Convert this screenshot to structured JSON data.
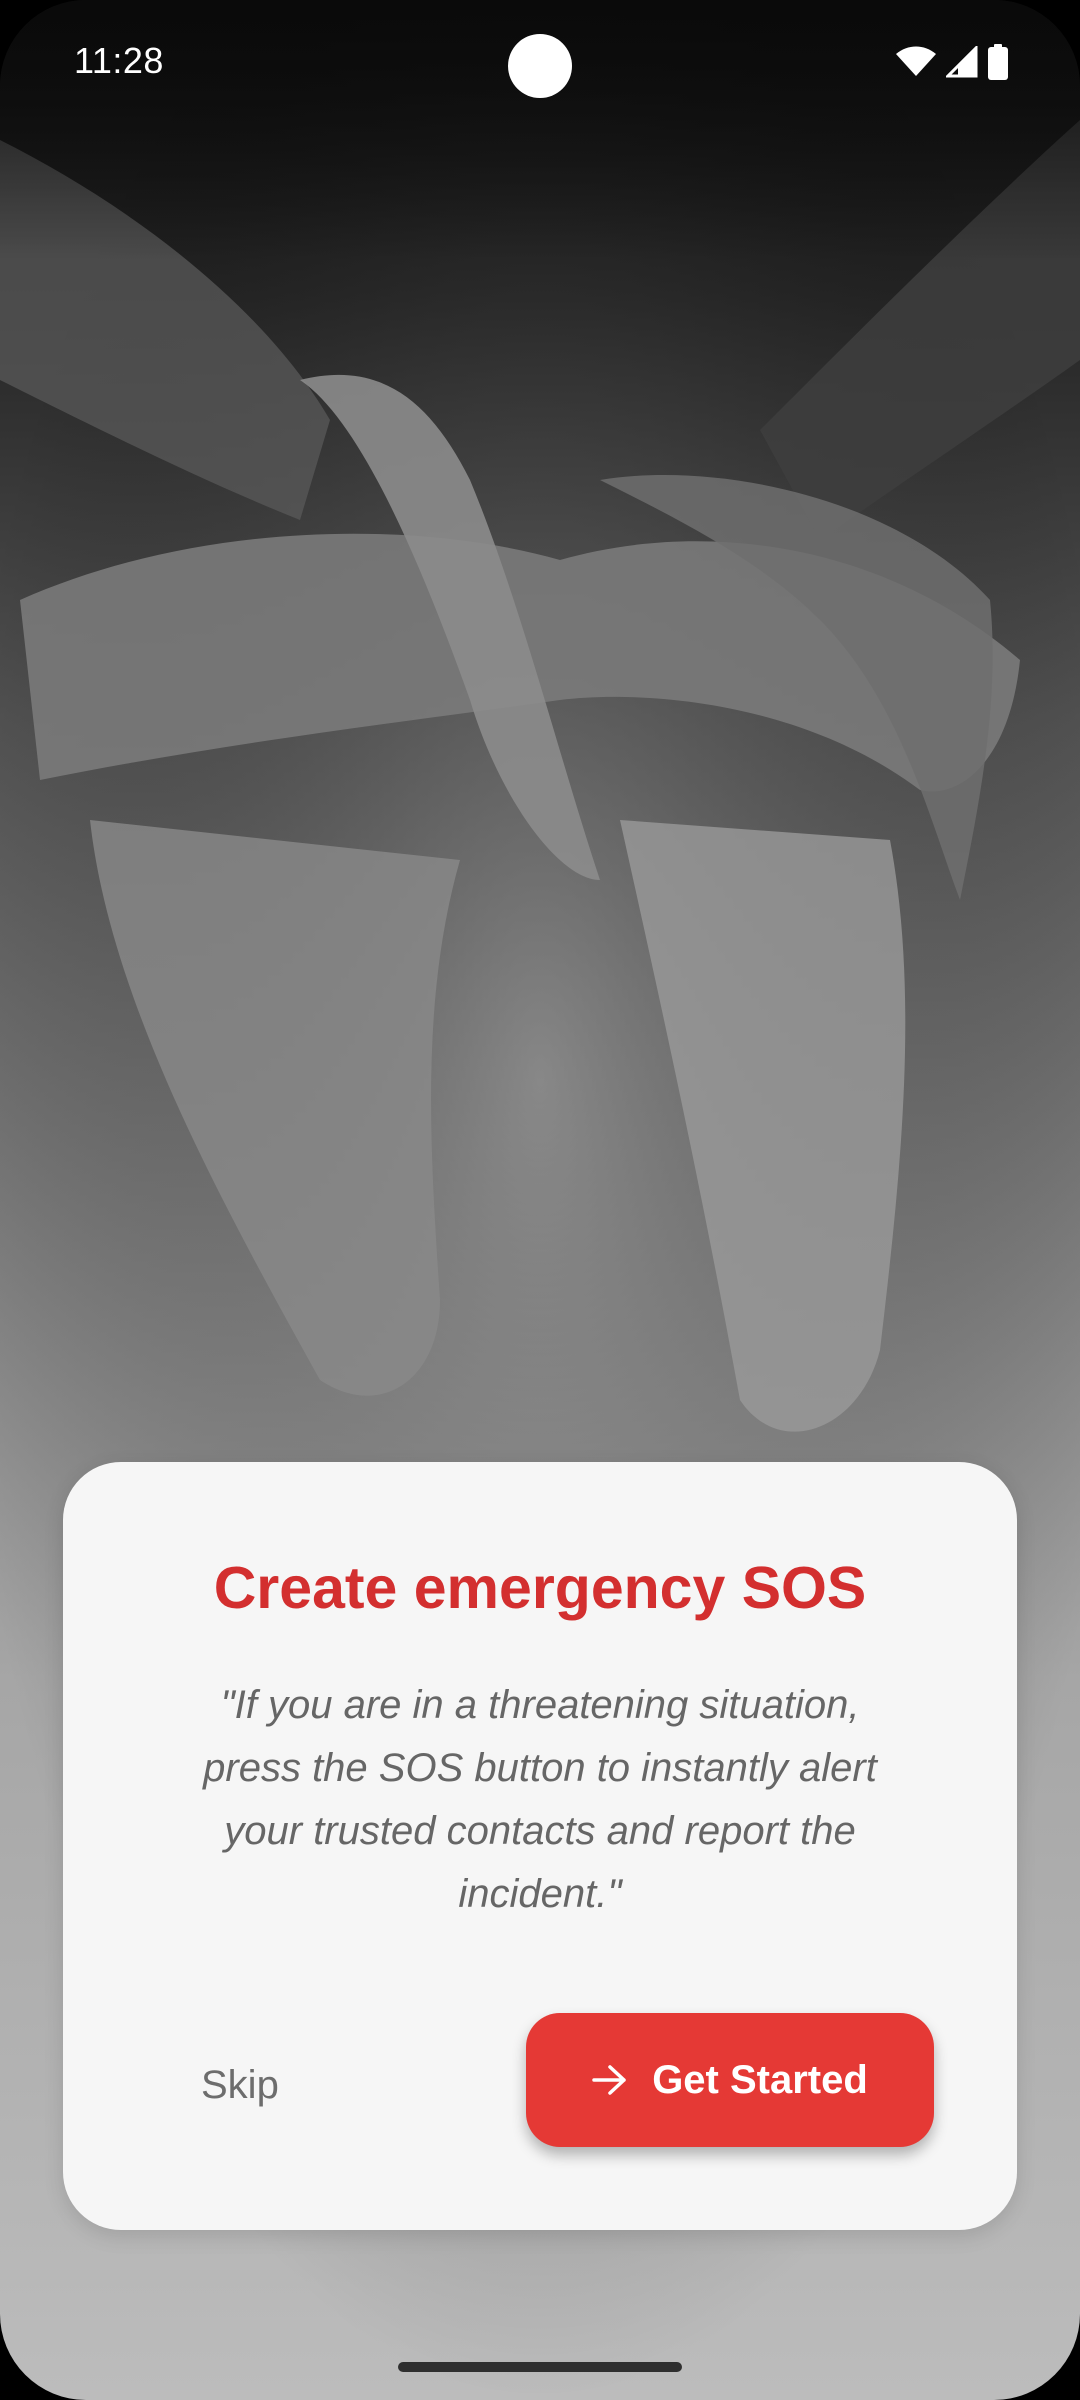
{
  "status_bar": {
    "time": "11:28",
    "icons": [
      "wifi-icon",
      "cellular-signal-icon",
      "battery-icon"
    ]
  },
  "background": {
    "image": "grayscale photo of hands tied with rope"
  },
  "card": {
    "title": "Create emergency SOS",
    "quote": "\"If you are in a threatening situation, press the SOS button to instantly alert your trusted contacts and report the incident.\"",
    "skip_label": "Skip",
    "start_label": "Get Started",
    "start_icon": "arrow-right-icon"
  },
  "colors": {
    "accent": "#e53935",
    "title": "#d32f2f",
    "card_bg": "#f6f6f6",
    "quote_text": "#666666"
  }
}
